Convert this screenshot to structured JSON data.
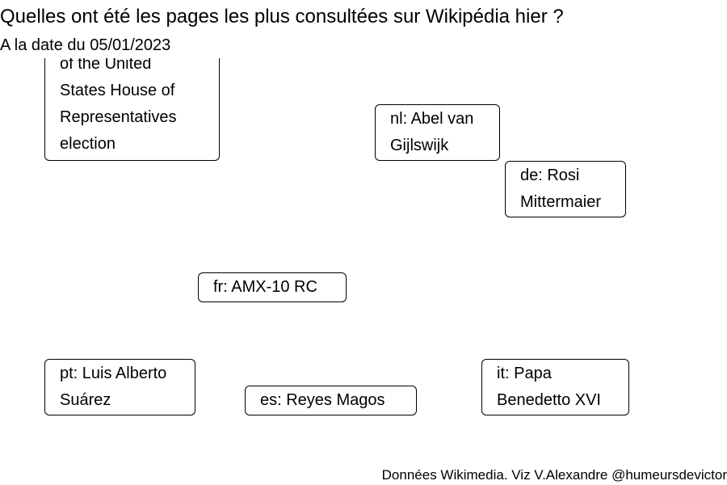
{
  "title": "Quelles ont été les pages les plus consultées sur Wikipédia hier ?",
  "subtitle": "A la date du 05/01/2023",
  "caption": "Données Wikimedia. Viz V.Alexandre @humeursdevictor",
  "chart_data": {
    "type": "text-label-scatter",
    "labels": [
      {
        "lang": "en",
        "text": "of the United States House of Representatives election",
        "visible_lines": [
          "of the United",
          "States House of",
          "Representatives",
          "election"
        ]
      },
      {
        "lang": "nl",
        "text": "nl: Abel van Gijlswijk",
        "visible_lines": [
          "nl: Abel van",
          "Gijlswijk"
        ]
      },
      {
        "lang": "de",
        "text": "de: Rosi Mittermaier",
        "visible_lines": [
          "de: Rosi",
          "Mittermaier"
        ]
      },
      {
        "lang": "fr",
        "text": "fr: AMX-10 RC",
        "visible_lines": [
          "fr: AMX-10 RC"
        ]
      },
      {
        "lang": "pt",
        "text": "pt: Luis Alberto Suárez",
        "visible_lines": [
          "pt: Luis Alberto",
          "Suárez"
        ]
      },
      {
        "lang": "es",
        "text": "es: Reyes Magos",
        "visible_lines": [
          "es: Reyes Magos"
        ]
      },
      {
        "lang": "it",
        "text": "it: Papa Benedetto XVI",
        "visible_lines": [
          "it: Papa",
          "Benedetto XVI"
        ]
      }
    ]
  }
}
